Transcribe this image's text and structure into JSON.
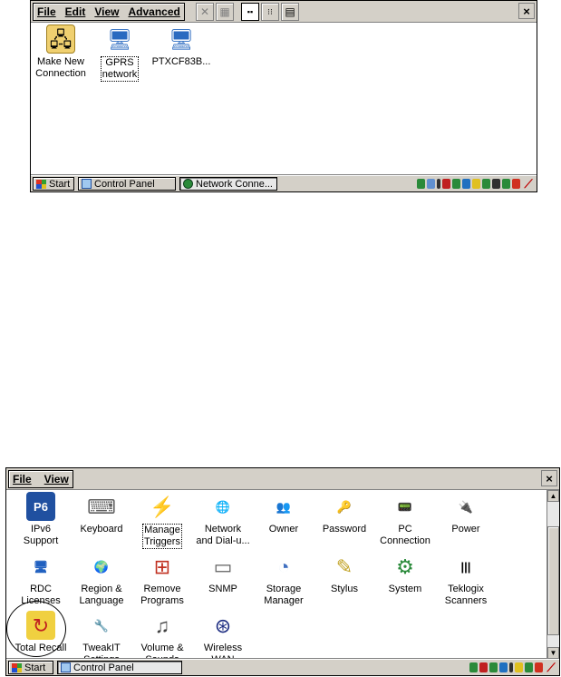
{
  "window1": {
    "menu": [
      "File",
      "Edit",
      "View",
      "Advanced"
    ],
    "close_label": "×",
    "items": [
      {
        "label_line1": "Make New",
        "label_line2": "Connection",
        "icon": "make-new-connection-icon",
        "focused": false
      },
      {
        "label_line1": "GPRS",
        "label_line2": "network",
        "icon": "gprs-network-icon",
        "focused": true
      },
      {
        "label_line1": "PTXCF83B...",
        "label_line2": "",
        "icon": "ptxcf83b-icon",
        "focused": false
      }
    ],
    "taskbar": {
      "start": "Start",
      "tasks": [
        "Control Panel",
        "Network Conne..."
      ]
    }
  },
  "window2": {
    "menu": [
      "File",
      "View"
    ],
    "close_label": "×",
    "items": [
      {
        "l1": "IPv6",
        "l2": "Support",
        "icon": "ipv6-icon"
      },
      {
        "l1": "Keyboard",
        "l2": "",
        "icon": "keyboard-icon"
      },
      {
        "l1": "Manage",
        "l2": "Triggers",
        "icon": "manage-triggers-icon"
      },
      {
        "l1": "Network",
        "l2": "and Dial-u...",
        "icon": "network-dialup-icon"
      },
      {
        "l1": "Owner",
        "l2": "",
        "icon": "owner-icon"
      },
      {
        "l1": "Password",
        "l2": "",
        "icon": "password-icon"
      },
      {
        "l1": "PC",
        "l2": "Connection",
        "icon": "pc-connection-icon"
      },
      {
        "l1": "Power",
        "l2": "",
        "icon": "power-icon"
      },
      {
        "l1": "RDC",
        "l2": "Licenses",
        "icon": "rdc-licenses-icon"
      },
      {
        "l1": "Region &",
        "l2": "Language",
        "icon": "region-language-icon"
      },
      {
        "l1": "Remove",
        "l2": "Programs",
        "icon": "remove-programs-icon"
      },
      {
        "l1": "SNMP",
        "l2": "",
        "icon": "snmp-icon"
      },
      {
        "l1": "Storage",
        "l2": "Manager",
        "icon": "storage-manager-icon"
      },
      {
        "l1": "Stylus",
        "l2": "",
        "icon": "stylus-icon"
      },
      {
        "l1": "System",
        "l2": "",
        "icon": "system-icon"
      },
      {
        "l1": "Teklogix",
        "l2": "Scanners",
        "icon": "teklogix-scanners-icon"
      },
      {
        "l1": "Total Recall",
        "l2": "",
        "icon": "total-recall-icon"
      },
      {
        "l1": "TweakIT",
        "l2": "Settings",
        "icon": "tweakit-settings-icon"
      },
      {
        "l1": "Volume &",
        "l2": "Sounds",
        "icon": "volume-sounds-icon"
      },
      {
        "l1": "Wireless",
        "l2": "WAN",
        "icon": "wireless-wan-icon"
      }
    ],
    "taskbar": {
      "start": "Start",
      "tasks": [
        "Control Panel"
      ]
    }
  }
}
